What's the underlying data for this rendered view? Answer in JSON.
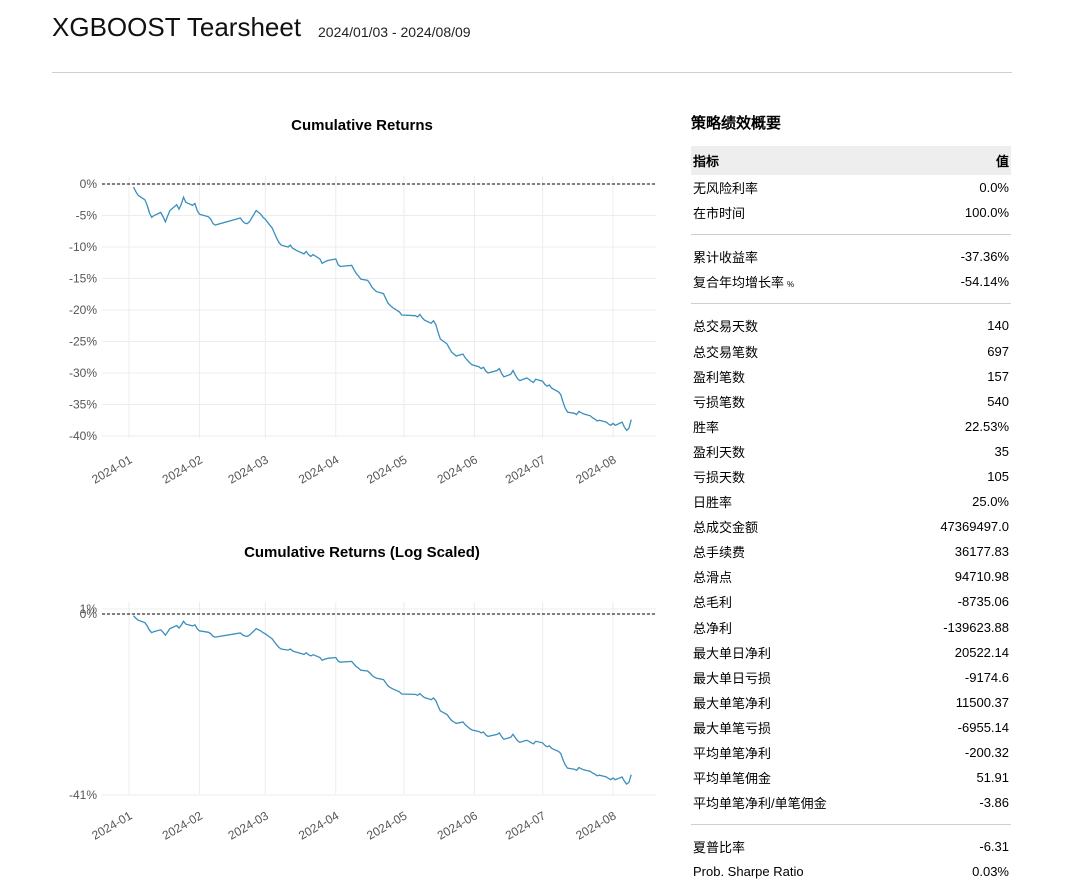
{
  "header": {
    "title": "XGBOOST Tearsheet",
    "date_range": "2024/01/03 - 2024/08/09"
  },
  "chart_data": [
    {
      "type": "line",
      "title": "Cumulative Returns",
      "xlabel": "",
      "ylabel": "",
      "x_ticks": [
        "2024-01",
        "2024-02",
        "2024-03",
        "2024-04",
        "2024-05",
        "2024-06",
        "2024-07",
        "2024-08"
      ],
      "y_ticks": [
        "0%",
        "-5%",
        "-10%",
        "-15%",
        "-20%",
        "-25%",
        "-30%",
        "-35%",
        "-40%"
      ],
      "ylim": [
        -40,
        0
      ],
      "grid": true,
      "baseline": 0,
      "series": [
        {
          "color": "#3a8fbd",
          "x": [
            "2024-01-03",
            "2024-01-04",
            "2024-01-05",
            "2024-01-08",
            "2024-01-09",
            "2024-01-10",
            "2024-01-11",
            "2024-01-12",
            "2024-01-15",
            "2024-01-16",
            "2024-01-17",
            "2024-01-18",
            "2024-01-19",
            "2024-01-22",
            "2024-01-23",
            "2024-01-24",
            "2024-01-25",
            "2024-01-26",
            "2024-01-29",
            "2024-01-30",
            "2024-01-31",
            "2024-02-01",
            "2024-02-02",
            "2024-02-05",
            "2024-02-06",
            "2024-02-07",
            "2024-02-08",
            "2024-02-19",
            "2024-02-20",
            "2024-02-21",
            "2024-02-22",
            "2024-02-23",
            "2024-02-26",
            "2024-02-27",
            "2024-02-28",
            "2024-02-29",
            "2024-03-01",
            "2024-03-04",
            "2024-03-05",
            "2024-03-06",
            "2024-03-07",
            "2024-03-08",
            "2024-03-11",
            "2024-03-12",
            "2024-03-13",
            "2024-03-14",
            "2024-03-15",
            "2024-03-18",
            "2024-03-19",
            "2024-03-20",
            "2024-03-21",
            "2024-03-22",
            "2024-03-25",
            "2024-03-26",
            "2024-03-27",
            "2024-03-28",
            "2024-03-29",
            "2024-04-01",
            "2024-04-02",
            "2024-04-03",
            "2024-04-08",
            "2024-04-09",
            "2024-04-10",
            "2024-04-11",
            "2024-04-12",
            "2024-04-15",
            "2024-04-16",
            "2024-04-17",
            "2024-04-18",
            "2024-04-19",
            "2024-04-22",
            "2024-04-23",
            "2024-04-24",
            "2024-04-25",
            "2024-04-26",
            "2024-04-29",
            "2024-04-30",
            "2024-05-06",
            "2024-05-07",
            "2024-05-08",
            "2024-05-09",
            "2024-05-10",
            "2024-05-13",
            "2024-05-14",
            "2024-05-15",
            "2024-05-16",
            "2024-05-17",
            "2024-05-20",
            "2024-05-21",
            "2024-05-22",
            "2024-05-23",
            "2024-05-24",
            "2024-05-27",
            "2024-05-28",
            "2024-05-29",
            "2024-05-30",
            "2024-05-31",
            "2024-06-03",
            "2024-06-04",
            "2024-06-05",
            "2024-06-06",
            "2024-06-07",
            "2024-06-11",
            "2024-06-12",
            "2024-06-13",
            "2024-06-14",
            "2024-06-17",
            "2024-06-18",
            "2024-06-19",
            "2024-06-20",
            "2024-06-21",
            "2024-06-24",
            "2024-06-25",
            "2024-06-26",
            "2024-06-27",
            "2024-06-28",
            "2024-07-01",
            "2024-07-02",
            "2024-07-03",
            "2024-07-04",
            "2024-07-05",
            "2024-07-08",
            "2024-07-09",
            "2024-07-10",
            "2024-07-11",
            "2024-07-12",
            "2024-07-15",
            "2024-07-16",
            "2024-07-17",
            "2024-07-18",
            "2024-07-19",
            "2024-07-22",
            "2024-07-23",
            "2024-07-24",
            "2024-07-25",
            "2024-07-26",
            "2024-07-29",
            "2024-07-30",
            "2024-07-31",
            "2024-08-01",
            "2024-08-02",
            "2024-08-05",
            "2024-08-06",
            "2024-08-07",
            "2024-08-08",
            "2024-08-09"
          ],
          "y": [
            -0.5,
            -1.2,
            -1.8,
            -2.5,
            -3.4,
            -4.6,
            -5.3,
            -5.0,
            -4.5,
            -5.2,
            -6.0,
            -5.1,
            -4.2,
            -3.3,
            -4.0,
            -3.2,
            -2.1,
            -2.9,
            -3.4,
            -3.1,
            -4.2,
            -4.8,
            -4.9,
            -5.2,
            -5.6,
            -6.3,
            -6.5,
            -5.4,
            -5.9,
            -6.2,
            -6.3,
            -6.0,
            -4.2,
            -4.5,
            -4.8,
            -5.3,
            -5.6,
            -7.0,
            -7.8,
            -8.6,
            -9.3,
            -9.7,
            -10.0,
            -9.7,
            -10.2,
            -10.4,
            -10.6,
            -11.1,
            -10.7,
            -11.2,
            -11.5,
            -11.2,
            -11.9,
            -12.6,
            -12.4,
            -12.2,
            -12.1,
            -11.9,
            -12.8,
            -13.1,
            -12.9,
            -13.6,
            -14.2,
            -14.6,
            -15.1,
            -15.3,
            -15.8,
            -16.4,
            -16.8,
            -17.1,
            -17.4,
            -18.2,
            -18.9,
            -19.3,
            -19.6,
            -20.3,
            -20.8,
            -20.9,
            -21.1,
            -20.7,
            -21.2,
            -21.6,
            -22.1,
            -21.7,
            -22.3,
            -23.5,
            -24.6,
            -25.4,
            -26.1,
            -26.7,
            -27.0,
            -27.3,
            -27.0,
            -27.6,
            -28.0,
            -28.4,
            -28.7,
            -29.0,
            -29.3,
            -29.1,
            -29.7,
            -30.0,
            -29.6,
            -29.3,
            -30.1,
            -30.6,
            -30.2,
            -29.6,
            -30.3,
            -30.9,
            -31.2,
            -30.8,
            -31.0,
            -31.3,
            -31.5,
            -31.0,
            -31.3,
            -31.8,
            -32.1,
            -31.9,
            -32.4,
            -33.0,
            -33.4,
            -34.6,
            -35.6,
            -36.2,
            -36.4,
            -36.6,
            -36.1,
            -36.3,
            -36.5,
            -36.8,
            -37.1,
            -37.3,
            -37.6,
            -37.5,
            -37.8,
            -38.1,
            -38.3,
            -38.0,
            -38.3,
            -37.8,
            -38.6,
            -39.1,
            -38.8,
            -37.4
          ]
        }
      ]
    },
    {
      "type": "line",
      "title": "Cumulative Returns (Log Scaled)",
      "xlabel": "",
      "ylabel": "",
      "scale": "log",
      "x_ticks": [
        "2024-01",
        "2024-02",
        "2024-03",
        "2024-04",
        "2024-05",
        "2024-06",
        "2024-07",
        "2024-08"
      ],
      "y_ticks": [
        "1%",
        "0%",
        "-41%"
      ],
      "grid": true,
      "baseline": 0,
      "series": [
        {
          "color": "#3a8fbd",
          "same_as_chart": 0
        }
      ]
    }
  ],
  "summary": {
    "title": "策略绩效概要",
    "col_metric": "指标",
    "col_value": "值",
    "groups": [
      [
        {
          "label": "无风险利率",
          "value": "0.0%"
        },
        {
          "label": "在市时间",
          "value": "100.0%"
        }
      ],
      [
        {
          "label": "累计收益率",
          "value": "-37.36%"
        },
        {
          "label": "复合年均增长率",
          "sub": "%",
          "value": "-54.14%"
        }
      ],
      [
        {
          "label": "总交易天数",
          "value": "140"
        },
        {
          "label": "总交易笔数",
          "value": "697"
        },
        {
          "label": "盈利笔数",
          "value": "157"
        },
        {
          "label": "亏损笔数",
          "value": "540"
        },
        {
          "label": "胜率",
          "value": "22.53%"
        },
        {
          "label": "盈利天数",
          "value": "35"
        },
        {
          "label": "亏损天数",
          "value": "105"
        },
        {
          "label": "日胜率",
          "value": "25.0%"
        },
        {
          "label": "总成交金额",
          "value": "47369497.0"
        },
        {
          "label": "总手续费",
          "value": "36177.83"
        },
        {
          "label": "总滑点",
          "value": "94710.98"
        },
        {
          "label": "总毛利",
          "value": "-8735.06"
        },
        {
          "label": "总净利",
          "value": "-139623.88"
        },
        {
          "label": "最大单日净利",
          "value": "20522.14"
        },
        {
          "label": "最大单日亏损",
          "value": "-9174.6"
        },
        {
          "label": "最大单笔净利",
          "value": "11500.37"
        },
        {
          "label": "最大单笔亏损",
          "value": "-6955.14"
        },
        {
          "label": "平均单笔净利",
          "value": "-200.32"
        },
        {
          "label": "平均单笔佣金",
          "value": "51.91"
        },
        {
          "label": "平均单笔净利/单笔佣金",
          "value": "-3.86"
        }
      ],
      [
        {
          "label": "夏普比率",
          "value": "-6.31"
        },
        {
          "label": "Prob. Sharpe Ratio",
          "value": "0.03%"
        }
      ]
    ]
  }
}
